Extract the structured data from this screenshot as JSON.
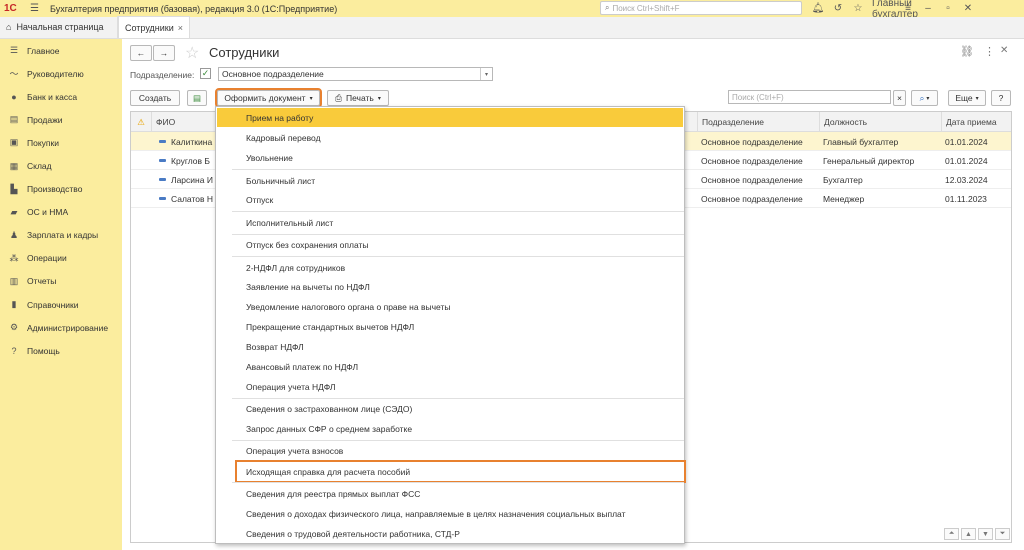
{
  "app": {
    "logo": "1С",
    "title": "Бухгалтерия предприятия (базовая), редакция 3.0  (1С:Предприятие)",
    "search_placeholder": "Поиск Ctrl+Shift+F",
    "user": "Главный бухгалтер"
  },
  "tabs": {
    "home": "Начальная страница",
    "current": "Сотрудники",
    "close": "×"
  },
  "sidebar": {
    "items": [
      {
        "label": "Главное",
        "icon": "menu-icon"
      },
      {
        "label": "Руководителю",
        "icon": "chart-line-icon"
      },
      {
        "label": "Банк и касса",
        "icon": "bank-icon"
      },
      {
        "label": "Продажи",
        "icon": "cart-icon"
      },
      {
        "label": "Покупки",
        "icon": "shopping-bag-icon"
      },
      {
        "label": "Склад",
        "icon": "warehouse-icon"
      },
      {
        "label": "Производство",
        "icon": "factory-icon"
      },
      {
        "label": "ОС и НМА",
        "icon": "truck-icon"
      },
      {
        "label": "Зарплата и кадры",
        "icon": "person-icon"
      },
      {
        "label": "Операции",
        "icon": "operations-icon"
      },
      {
        "label": "Отчеты",
        "icon": "report-icon"
      },
      {
        "label": "Справочники",
        "icon": "book-icon"
      },
      {
        "label": "Администрирование",
        "icon": "gear-icon"
      },
      {
        "label": "Помощь",
        "icon": "question-icon"
      }
    ]
  },
  "page": {
    "title": "Сотрудники",
    "subdivision_label": "Подразделение:",
    "subdivision_value": "Основное подразделение",
    "create_button": "Создать",
    "document_button": "Оформить документ",
    "print_button": "Печать",
    "search_placeholder": "Поиск (Ctrl+F)",
    "more_button": "Еще",
    "help_button": "?"
  },
  "table": {
    "headers": {
      "fio": "ФИО",
      "division": "Подразделение",
      "position": "Должность",
      "hire_date": "Дата приема"
    },
    "rows": [
      {
        "fio": "Калиткина",
        "division": "Основное подразделение",
        "position": "Главный бухгалтер",
        "hire_date": "01.01.2024"
      },
      {
        "fio": "Круглов Б",
        "division": "Основное подразделение",
        "position": "Генеральный директор",
        "hire_date": "01.01.2024"
      },
      {
        "fio": "Ларсина И",
        "division": "Основное подразделение",
        "position": "Бухгалтер",
        "hire_date": "12.03.2024"
      },
      {
        "fio": "Салатов Н",
        "division": "Основное подразделение",
        "position": "Менеджер",
        "hire_date": "01.11.2023"
      }
    ]
  },
  "menu": {
    "items": [
      "Прием на работу",
      "Кадровый перевод",
      "Увольнение",
      "Больничный лист",
      "Отпуск",
      "Исполнительный лист",
      "Отпуск без сохранения оплаты",
      "2-НДФЛ для сотрудников",
      "Заявление на вычеты по НДФЛ",
      "Уведомление налогового органа о праве на вычеты",
      "Прекращение стандартных вычетов НДФЛ",
      "Возврат НДФЛ",
      "Авансовый платеж по НДФЛ",
      "Операция учета НДФЛ",
      "Сведения о застрахованном лице (СЭДО)",
      "Запрос данных СФР о среднем заработке",
      "Операция учета взносов",
      "Исходящая справка для расчета пособий",
      "Сведения для реестра прямых выплат ФСС",
      "Сведения о доходах физического лица, направляемые в целях назначения социальных выплат",
      "Сведения о трудовой деятельности работника, СТД-Р"
    ]
  },
  "colors": {
    "accent": "#fbed9e",
    "selected": "#f9cb3b",
    "highlight": "#e8812f"
  }
}
